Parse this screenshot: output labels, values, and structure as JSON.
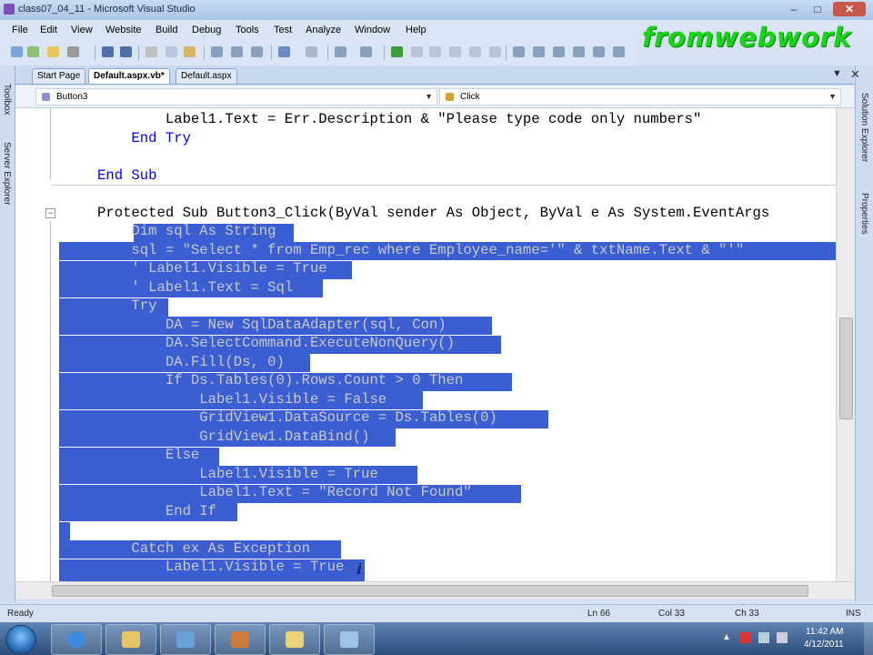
{
  "window": {
    "title": "class07_04_11 - Microsoft Visual Studio"
  },
  "watermark": "fromwebwork",
  "menu": [
    "File",
    "Edit",
    "View",
    "Website",
    "Build",
    "Debug",
    "Tools",
    "Test",
    "Analyze",
    "Window",
    "Help"
  ],
  "side_panels": {
    "left": [
      "Toolbox",
      "Server Explorer"
    ],
    "right": [
      "Solution Explorer",
      "Properties"
    ]
  },
  "tabs": [
    {
      "label": "Start Page",
      "active": false
    },
    {
      "label": "Default.aspx.vb*",
      "active": true
    },
    {
      "label": "Default.aspx",
      "active": false
    }
  ],
  "nav": {
    "object": "Button3",
    "method": "Click"
  },
  "code": [
    {
      "text": "        Label1.Text = Err.Description & \"Please type code only numbers\""
    },
    {
      "text": "    End Try"
    },
    {
      "text": ""
    },
    {
      "text": "End Sub"
    },
    {
      "text": ""
    },
    {
      "text": "Protected Sub Button3_Click(ByVal sender As Object, ByVal e As System.EventArgs"
    },
    {
      "text": "    Dim sql As String"
    },
    {
      "text": "    sql = \"Select * from Emp_rec where Employee_name='\" & txtName.Text & \"'\""
    },
    {
      "text": "    ' Label1.Visible = True"
    },
    {
      "text": "    ' Label1.Text = Sql"
    },
    {
      "text": "    Try"
    },
    {
      "text": "        DA = New SqlDataAdapter(sql, Con)"
    },
    {
      "text": "        DA.SelectCommand.ExecuteNonQuery()"
    },
    {
      "text": "        DA.Fill(Ds, 0)"
    },
    {
      "text": "        If Ds.Tables(0).Rows.Count > 0 Then"
    },
    {
      "text": "            Label1.Visible = False"
    },
    {
      "text": "            GridView1.DataSource = Ds.Tables(0)"
    },
    {
      "text": "            GridView1.DataBind()"
    },
    {
      "text": "        Else"
    },
    {
      "text": "            Label1.Visible = True"
    },
    {
      "text": "            Label1.Text = \"Record Not Found\""
    },
    {
      "text": "        End If"
    },
    {
      "text": ""
    },
    {
      "text": "    Catch ex As Exception"
    },
    {
      "text": "        Label1.Visible = True"
    }
  ],
  "status": {
    "ready": "Ready",
    "line": "Ln 66",
    "col": "Col 33",
    "ch": "Ch 33",
    "mode": "INS"
  },
  "clock": {
    "time": "11:42 AM",
    "date": "4/12/2011"
  },
  "colors": {
    "keyword": "#0000ff",
    "string": "#a31515",
    "comment": "#008000",
    "selection": "#3b5fd2"
  }
}
